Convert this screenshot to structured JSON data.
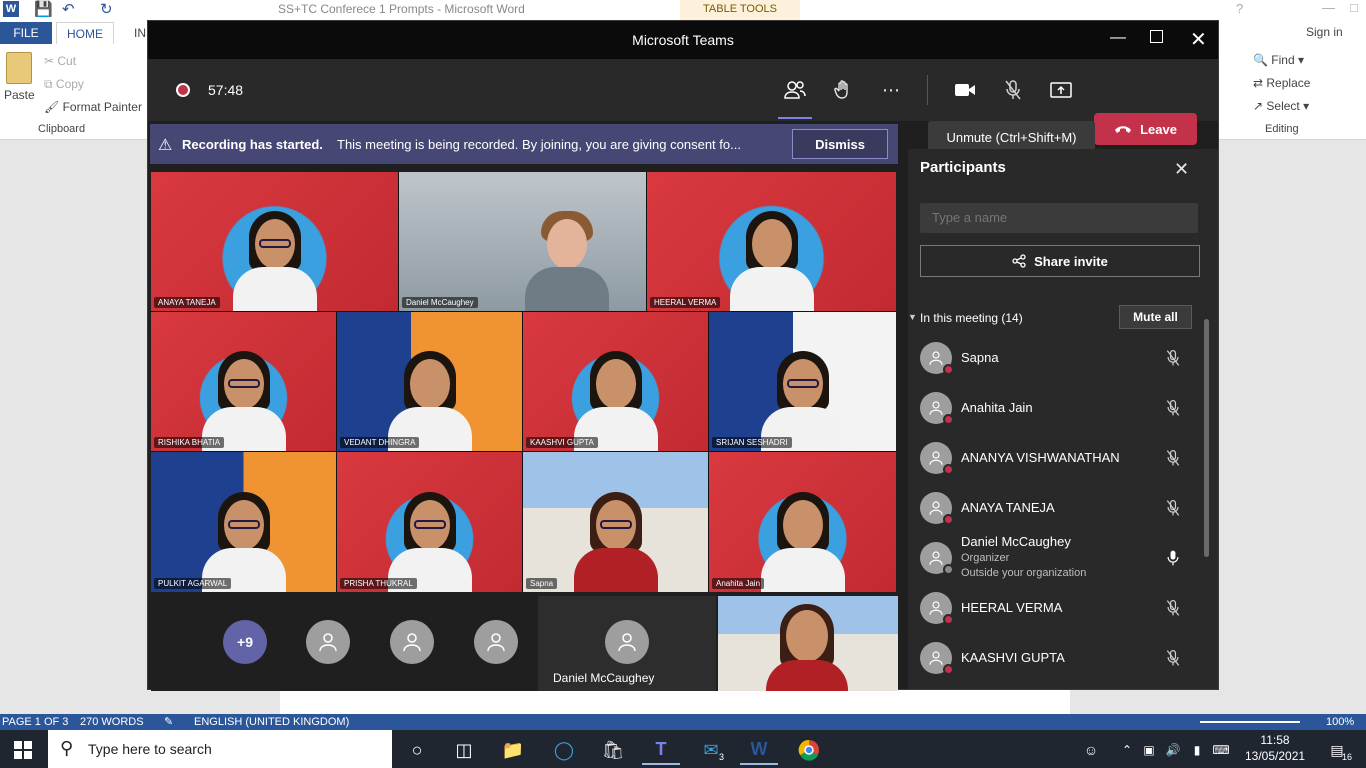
{
  "word": {
    "title": "SS+TC Conferece 1 Prompts - Microsoft Word",
    "table_tools": "TABLE TOOLS",
    "sign_in": "Sign in",
    "tabs": [
      "FILE",
      "HOME",
      "INS"
    ],
    "clipboard": {
      "paste": "Paste",
      "cut": "Cut",
      "copy": "Copy",
      "format_painter": "Format Painter",
      "group": "Clipboard"
    },
    "editing": {
      "find": "Find",
      "replace": "Replace",
      "select": "Select",
      "group": "Editing"
    },
    "status": {
      "page": "PAGE 1 OF 3",
      "words": "270 WORDS",
      "language": "ENGLISH (UNITED KINGDOM)",
      "zoom": "100%"
    }
  },
  "taskbar": {
    "search_placeholder": "Type here to search",
    "time": "11:58",
    "date": "13/05/2021",
    "mail_badge": "3",
    "notif_badge": "16"
  },
  "teams": {
    "title": "Microsoft Teams",
    "timer": "57:48",
    "leave_label": "Leave",
    "tooltip": "Unmute (Ctrl+Shift+M)",
    "banner": {
      "bold": "Recording has started.",
      "text": "This meeting is being recorded. By joining, you are giving consent fo...",
      "dismiss": "Dismiss"
    },
    "grid": [
      "ANAYA TANEJA",
      "Daniel McCaughey",
      "HEERAL VERMA",
      "RISHIKA BHATIA",
      "VEDANT DHINGRA",
      "KAASHVI GUPTA",
      "SRIJAN SESHADRI",
      "PULKIT AGARWAL",
      "PRISHA THUKRAL",
      "Sapna",
      "Anahita Jain"
    ],
    "strip": {
      "overflow": "+9",
      "organizer_tile": "Daniel McCaughey"
    },
    "panel": {
      "title": "Participants",
      "search_placeholder": "Type a name",
      "share": "Share invite",
      "section": "In this meeting (14)",
      "mute_all": "Mute all",
      "participants": [
        {
          "name": "Sapna",
          "muted": true
        },
        {
          "name": "Anahita Jain",
          "muted": true
        },
        {
          "name": "ANANYA VISHWANATHAN",
          "muted": true
        },
        {
          "name": "ANAYA TANEJA",
          "muted": true
        },
        {
          "name": "Daniel McCaughey",
          "role": "Organizer",
          "org": "Outside your organization",
          "muted": false
        },
        {
          "name": "HEERAL VERMA",
          "muted": true
        },
        {
          "name": "KAASHVI GUPTA",
          "muted": true
        }
      ]
    }
  },
  "colors": {
    "leave": "#c4314b",
    "banner": "#464775",
    "word_blue": "#2b579a"
  }
}
